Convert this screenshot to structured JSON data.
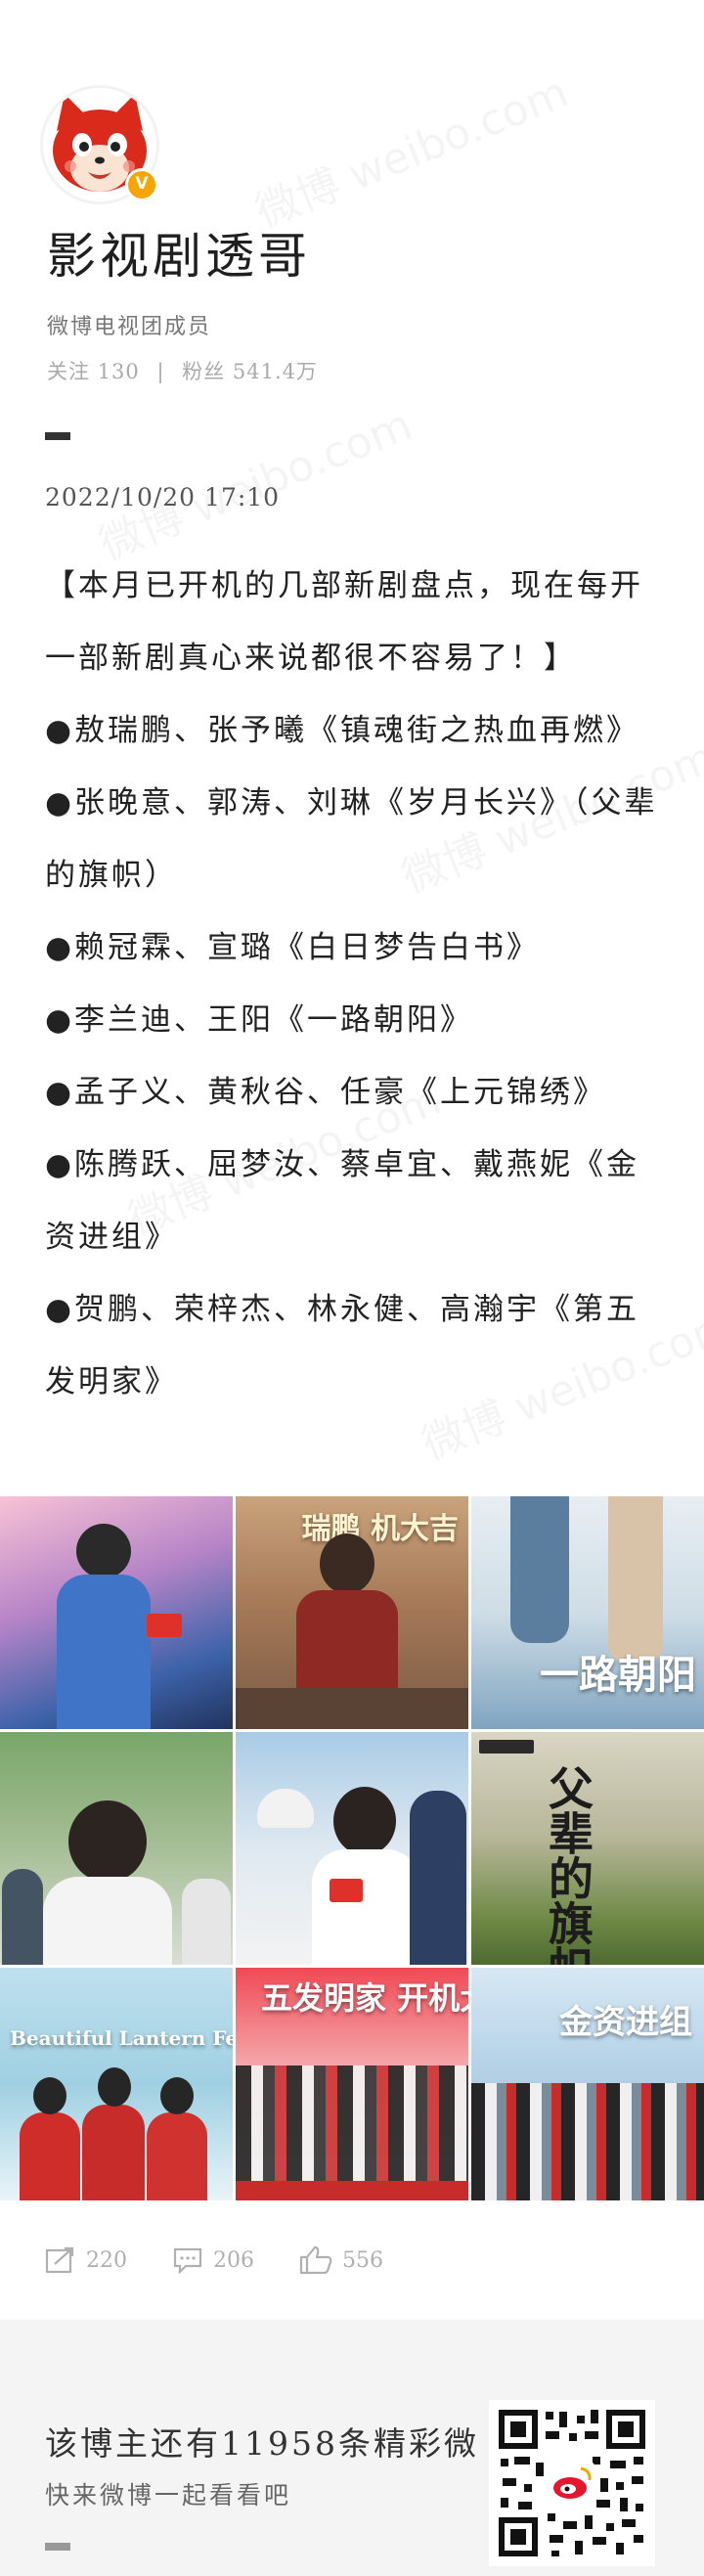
{
  "user": {
    "name": "影视剧透哥",
    "group": "微博电视团成员",
    "follow_label": "关注",
    "follow_count": "130",
    "fans_label": "粉丝",
    "fans_count": "541.4万",
    "verified_icon": "v-badge-icon"
  },
  "post": {
    "datetime": "2022/10/20 17:10",
    "lines": [
      "【本月已开机的几部新剧盘点，现在每开一部新剧真心来说都很不容易了！】",
      "●敖瑞鹏、张予曦《镇魂街之热血再燃》",
      "●张晚意、郭涛、刘琳《岁月长兴》（父辈的旗帜）",
      "●赖冠霖、宣璐《白日梦告白书》",
      "●李兰迪、王阳《一路朝阳》",
      "●孟子义、黄秋谷、任豪《上元锦绣》",
      "●陈腾跃、屈梦汝、蔡卓宜、戴燕妮《金资进组》",
      "●贺鹏、荣梓杰、林永健、高瀚宇《第五发明家》"
    ]
  },
  "images": {
    "captions": [
      "瑞鹏 机大吉",
      "一路朝阳",
      "父辈的旗帜",
      "Beautiful Lantern Festival",
      "五发明家 开机大吉",
      "金资进组"
    ]
  },
  "actions": {
    "repost_count": "220",
    "comment_count": "206",
    "like_count": "556"
  },
  "footer": {
    "promo_line1": "该博主还有11958条精彩微",
    "promo_line2": "快来微博一起看看吧"
  },
  "watermark": "微博 weibo.com",
  "colors": {
    "badge": "#f7a500",
    "avatar_red": "#d92a1c",
    "text": "#222222",
    "muted": "#aaaaaa"
  }
}
